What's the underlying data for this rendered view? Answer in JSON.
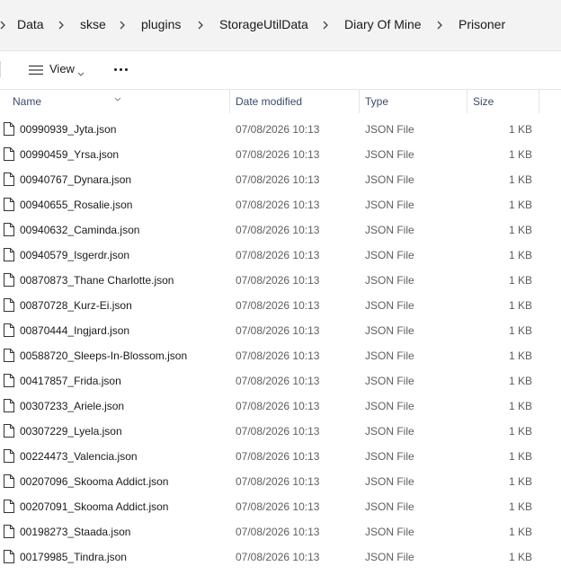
{
  "breadcrumb": [
    "Data",
    "skse",
    "plugins",
    "StorageUtilData",
    "Diary Of Mine",
    "Prisoner"
  ],
  "toolbar": {
    "view_label": "View"
  },
  "columns": {
    "name": "Name",
    "date": "Date modified",
    "type": "Type",
    "size": "Size"
  },
  "files": [
    {
      "name": "00990939_Jyta.json",
      "date": "07/08/2026 10:13",
      "type": "JSON File",
      "size": "1 KB"
    },
    {
      "name": "00990459_Yrsa.json",
      "date": "07/08/2026 10:13",
      "type": "JSON File",
      "size": "1 KB"
    },
    {
      "name": "00940767_Dynara.json",
      "date": "07/08/2026 10:13",
      "type": "JSON File",
      "size": "1 KB"
    },
    {
      "name": "00940655_Rosalie.json",
      "date": "07/08/2026 10:13",
      "type": "JSON File",
      "size": "1 KB"
    },
    {
      "name": "00940632_Caminda.json",
      "date": "07/08/2026 10:13",
      "type": "JSON File",
      "size": "1 KB"
    },
    {
      "name": "00940579_Isgerdr.json",
      "date": "07/08/2026 10:13",
      "type": "JSON File",
      "size": "1 KB"
    },
    {
      "name": "00870873_Thane Charlotte.json",
      "date": "07/08/2026 10:13",
      "type": "JSON File",
      "size": "1 KB"
    },
    {
      "name": "00870728_Kurz-Ei.json",
      "date": "07/08/2026 10:13",
      "type": "JSON File",
      "size": "1 KB"
    },
    {
      "name": "00870444_Ingjard.json",
      "date": "07/08/2026 10:13",
      "type": "JSON File",
      "size": "1 KB"
    },
    {
      "name": "00588720_Sleeps-In-Blossom.json",
      "date": "07/08/2026 10:13",
      "type": "JSON File",
      "size": "1 KB"
    },
    {
      "name": "00417857_Frida.json",
      "date": "07/08/2026 10:13",
      "type": "JSON File",
      "size": "1 KB"
    },
    {
      "name": "00307233_Ariele.json",
      "date": "07/08/2026 10:13",
      "type": "JSON File",
      "size": "1 KB"
    },
    {
      "name": "00307229_Lyela.json",
      "date": "07/08/2026 10:13",
      "type": "JSON File",
      "size": "1 KB"
    },
    {
      "name": "00224473_Valencia.json",
      "date": "07/08/2026 10:13",
      "type": "JSON File",
      "size": "1 KB"
    },
    {
      "name": "00207096_Skooma Addict.json",
      "date": "07/08/2026 10:13",
      "type": "JSON File",
      "size": "1 KB"
    },
    {
      "name": "00207091_Skooma Addict.json",
      "date": "07/08/2026 10:13",
      "type": "JSON File",
      "size": "1 KB"
    },
    {
      "name": "00198273_Staada.json",
      "date": "07/08/2026 10:13",
      "type": "JSON File",
      "size": "1 KB"
    },
    {
      "name": "00179985_Tindra.json",
      "date": "07/08/2026 10:13",
      "type": "JSON File",
      "size": "1 KB"
    }
  ],
  "icons": {
    "chevron": "chevron-right-icon",
    "view": "view-list-icon",
    "more": "more-horizontal-icon",
    "file": "file-icon",
    "sort": "sort-indicator-icon"
  }
}
